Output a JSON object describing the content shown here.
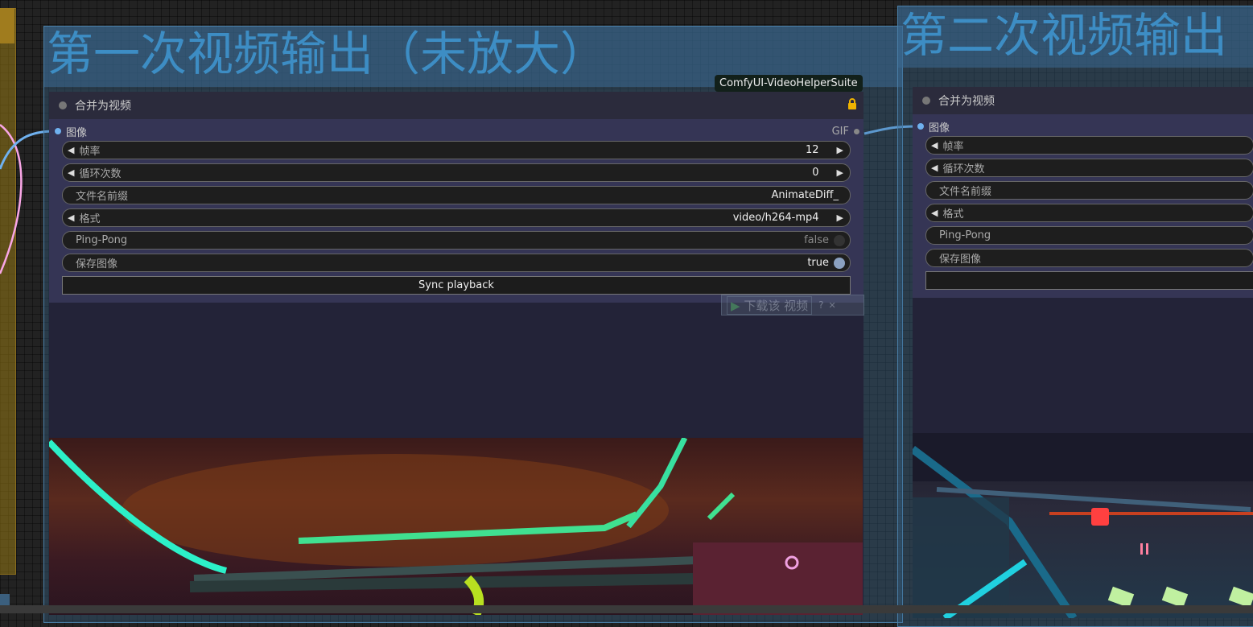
{
  "groups": [
    {
      "title": "第一次视频输出（未放大）"
    },
    {
      "title": "第二次视频输出（"
    }
  ],
  "badge": "ComfyUI-VideoHelperSuite",
  "lock_icon": "lock-icon",
  "colors": {
    "group_title": "#3d8dc4",
    "link": "#6fb1ef",
    "link_pink": "#f9a6e6",
    "badge_bg": "#12201a"
  },
  "node1": {
    "title": "合并为视频",
    "input_label": "图像",
    "output_label": "GIF",
    "widgets": [
      {
        "label": "帧率",
        "value": "12",
        "type": "number"
      },
      {
        "label": "循环次数",
        "value": "0",
        "type": "number"
      },
      {
        "label": "文件名前缀",
        "value": "AnimateDiff_",
        "type": "text"
      },
      {
        "label": "格式",
        "value": "video/h264-mp4",
        "type": "combo"
      },
      {
        "label": "Ping-Pong",
        "value": "false",
        "type": "toggle"
      },
      {
        "label": "保存图像",
        "value": "true",
        "type": "toggle"
      }
    ],
    "button": "Sync playback"
  },
  "node2": {
    "title": "合并为视频",
    "input_label": "图像",
    "widgets": [
      {
        "label": "帧率"
      },
      {
        "label": "循环次数"
      },
      {
        "label": "文件名前缀"
      },
      {
        "label": "格式"
      },
      {
        "label": "Ping-Pong"
      },
      {
        "label": "保存图像"
      }
    ]
  },
  "download_overlay": {
    "label": "下载该 视频",
    "help": "?",
    "close": "✕"
  }
}
